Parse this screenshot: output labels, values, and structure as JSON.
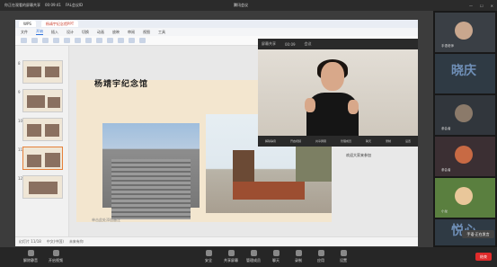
{
  "meeting": {
    "title": "腾讯会议",
    "top_left": [
      "你正在观看的屏幕共享",
      "00:09:41",
      "FAL会议ID"
    ],
    "window_controls": [
      "—",
      "☐",
      "✕"
    ]
  },
  "wps": {
    "tabs": [
      "WPS",
      "杨靖宇纪念馆PPT"
    ],
    "menu": [
      "文件",
      "开始",
      "插入",
      "设计",
      "切换",
      "动画",
      "放映",
      "审阅",
      "视图",
      "工具"
    ],
    "active_menu": "开始",
    "slide_title": "杨靖宇纪念馆",
    "notes": "单击此处添加备注",
    "status": [
      "幻灯片 11/18",
      "中文(中国)",
      "未来有你"
    ],
    "thumb_numbers": [
      "8",
      "9",
      "10",
      "11",
      "12"
    ]
  },
  "mini_meeting": {
    "bar": [
      "屏幕共享",
      "00:09",
      "会议"
    ],
    "tools": [
      "解除静音",
      "开启视频",
      "共享屏幕",
      "管理成员",
      "聊天",
      "录制",
      "设置"
    ],
    "chat": "欢迎大家来参加"
  },
  "participants": [
    {
      "name": "手语老师",
      "kind": "cam"
    },
    {
      "name": "晓庆",
      "kind": "text"
    },
    {
      "name": "参会者",
      "kind": "cam"
    },
    {
      "name": "参会者",
      "kind": "cam"
    },
    {
      "name": "小龙",
      "kind": "cartoon"
    },
    {
      "name": "悦心",
      "kind": "text"
    }
  ],
  "toolbar": {
    "items": [
      "解除静音",
      "开启视频",
      "安全",
      "共享屏幕",
      "管理成员",
      "聊天",
      "录制",
      "应用",
      "设置"
    ],
    "end": "结束"
  },
  "toast": "手语·正在发言",
  "colors": {
    "accent": "#e5803a",
    "end": "#e02b2b"
  }
}
